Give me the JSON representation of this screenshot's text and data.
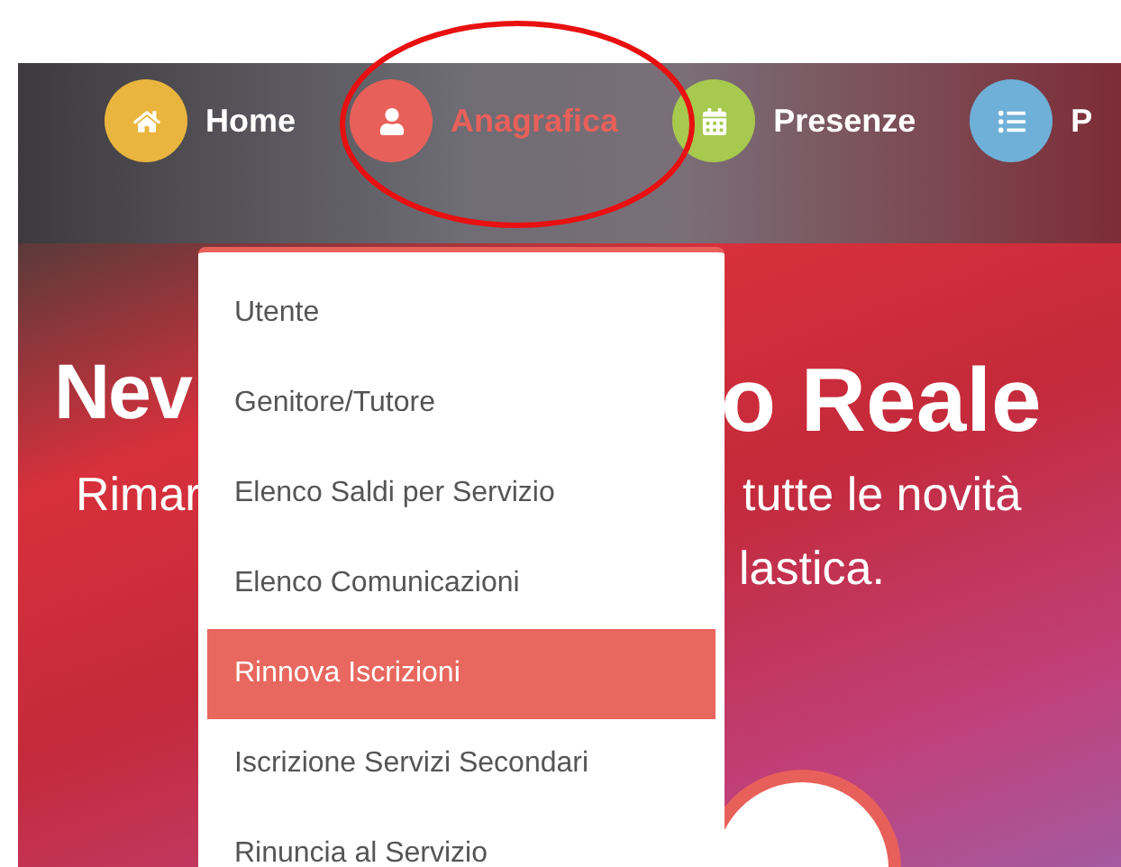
{
  "nav": [
    {
      "label": "Home",
      "color": "#e9b53e",
      "selected": false
    },
    {
      "label": "Anagrafica",
      "color": "#e8605a",
      "selected": true
    },
    {
      "label": "Presenze",
      "color": "#a6c94e",
      "selected": false
    },
    {
      "label": "P",
      "color": "#6fb0d8",
      "selected": false
    }
  ],
  "dropdown": [
    {
      "label": "Utente",
      "selected": false
    },
    {
      "label": "Genitore/Tutore",
      "selected": false
    },
    {
      "label": "Elenco Saldi per Servizio",
      "selected": false
    },
    {
      "label": "Elenco Comunicazioni",
      "selected": false
    },
    {
      "label": "Rinnova Iscrizioni",
      "selected": true
    },
    {
      "label": "Iscrizione Servizi Secondari",
      "selected": false
    },
    {
      "label": "Rinuncia al Servizio",
      "selected": false
    }
  ],
  "hero": {
    "title_left": "Nev",
    "title_right": "o Reale",
    "subtitle_left": "Rimar",
    "subtitle_right": "tutte le novità",
    "subtitle_line2": "lastica."
  }
}
